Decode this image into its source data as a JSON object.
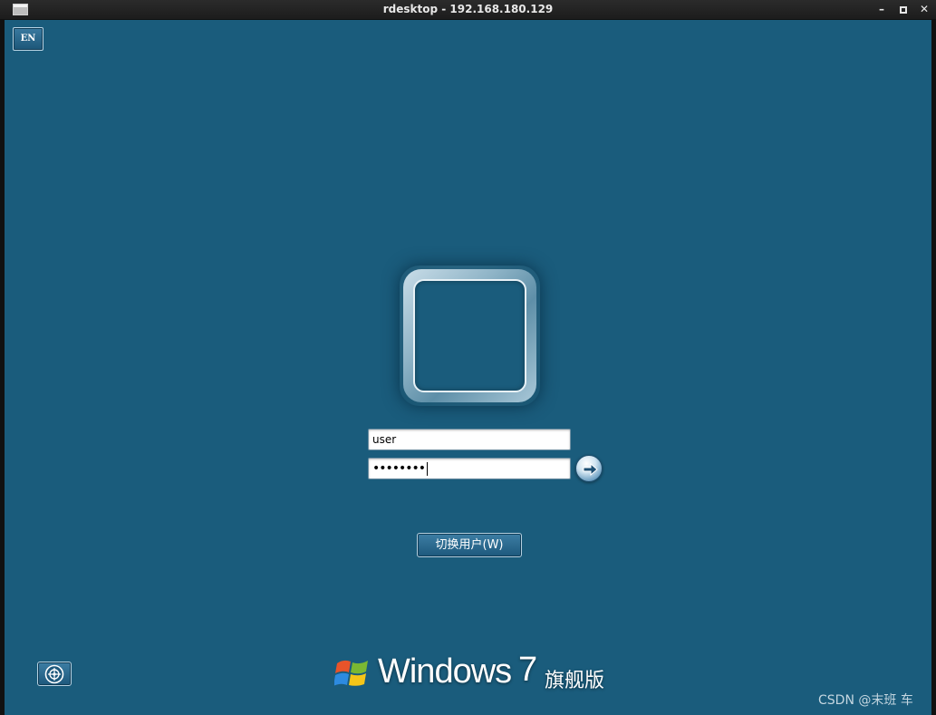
{
  "window": {
    "title": "rdesktop - 192.168.180.129",
    "controls": {
      "minimize": "–",
      "close": "✕"
    }
  },
  "login": {
    "language": "EN",
    "username_value": "user",
    "password_mask": "••••••••",
    "submit_icon": "arrow-right-icon",
    "switch_user_label": "切换用户(W)",
    "ease_of_access_icon": "ease-of-access-icon"
  },
  "branding": {
    "product": "Windows",
    "version": "7",
    "edition": "旗舰版"
  },
  "watermark": "CSDN @末班 车",
  "colors": {
    "background": "#1a5c7c",
    "titlebar": "#1c1c1c"
  }
}
